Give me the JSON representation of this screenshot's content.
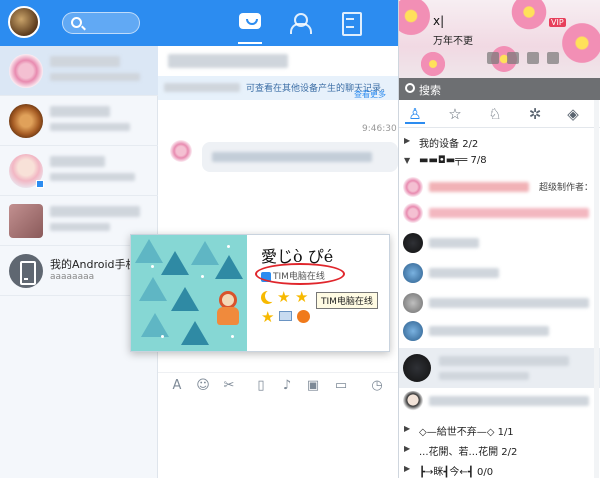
{
  "middle": {
    "notice": "可查看在其他设备产生的聊天记录。",
    "notice_link": "查看更多",
    "timestamp": "9:46:30"
  },
  "chat_list": {
    "phone_item": {
      "title": "我的Android手机",
      "subtitle": "aaaaaaaa"
    }
  },
  "toolbar": {
    "icons": [
      "font-icon",
      "emoji-icon",
      "screenshot-icon",
      "shake-icon",
      "voice-icon",
      "image-icon",
      "folder-icon",
      "history-icon"
    ]
  },
  "profile_card": {
    "name": "愛じò ぴé",
    "status": "TIM电脑在线",
    "tooltip": "TIM电脑在线"
  },
  "right_panel": {
    "banner": {
      "name": "x|",
      "signature": "万年不更",
      "vip": "VIP"
    },
    "search_label": "搜索",
    "groups": [
      {
        "name": "我的设备",
        "count": "2/2",
        "expanded": false
      },
      {
        "name": "▬▬◘▬╤═",
        "count": "7/8",
        "expanded": true
      },
      {
        "name": "◇—給世不弃—◇",
        "count": "1/1",
        "expanded": false
      },
      {
        "name": "...花開、若...花開",
        "count": "2/2",
        "expanded": false
      },
      {
        "name": "┣→眯┫今←┫",
        "count": "0/0",
        "expanded": false
      }
    ],
    "super_creator": "超级制作者："
  },
  "colors": {
    "accent": "#2c8cf0",
    "highlight_ellipse": "#e0262c"
  }
}
